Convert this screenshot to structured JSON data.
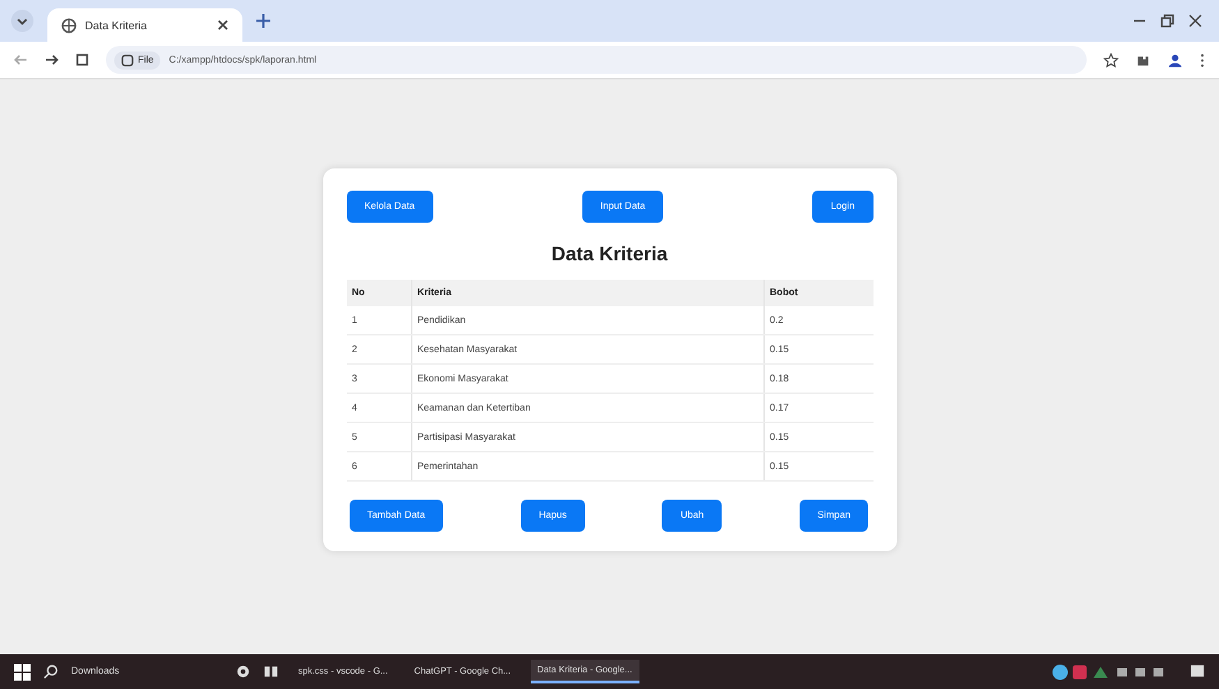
{
  "browser": {
    "tab_title": "Data Kriteria",
    "url_scheme": "File",
    "url": "C:/xampp/htdocs/spk/laporan.html"
  },
  "top_buttons": [
    "Kelola Data",
    "Input Data",
    "Login"
  ],
  "heading": "Data Kriteria",
  "table": {
    "columns": [
      "No",
      "Kriteria",
      "Bobot"
    ],
    "rows": [
      [
        "1",
        "Pendidikan",
        "0.2"
      ],
      [
        "2",
        "Kesehatan Masyarakat",
        "0.15"
      ],
      [
        "3",
        "Ekonomi Masyarakat",
        "0.18"
      ],
      [
        "4",
        "Keamanan dan Ketertiban",
        "0.17"
      ],
      [
        "5",
        "Partisipasi Masyarakat",
        "0.15"
      ],
      [
        "6",
        "Pemerintahan",
        "0.15"
      ]
    ]
  },
  "bottom_buttons": [
    "Tambah Data",
    "Hapus",
    "Ubah",
    "Simpan"
  ],
  "taskbar": {
    "search": "Downloads",
    "apps": [
      {
        "label": "spk.css - vscode - G...",
        "active": false
      },
      {
        "label": "ChatGPT - Google Ch...",
        "active": false
      },
      {
        "label": "Data Kriteria - Google...",
        "active": true
      }
    ]
  }
}
